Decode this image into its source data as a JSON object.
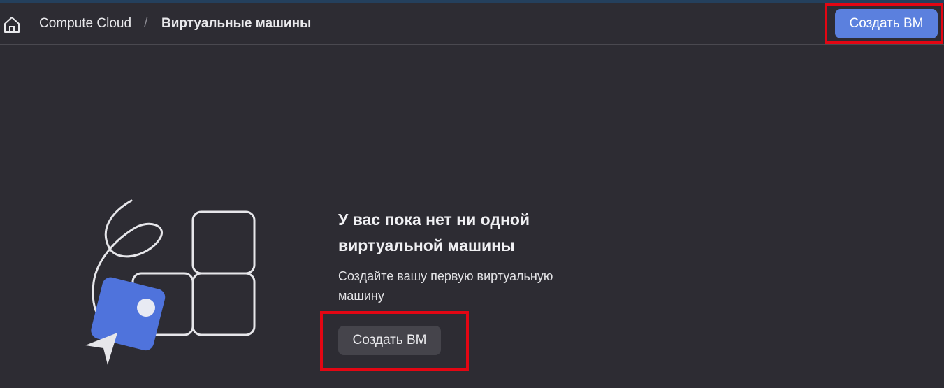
{
  "header": {
    "breadcrumb": {
      "service": "Compute Cloud",
      "separator": "/",
      "current": "Виртуальные машины"
    },
    "create_button_label": "Создать ВМ"
  },
  "empty_state": {
    "title": "У вас пока нет ни одной виртуальной машины",
    "description": "Создайте вашу первую виртуальную машину",
    "create_button_label": "Создать ВМ",
    "illustration_icon": "empty-vm-illustration"
  },
  "colors": {
    "background": "#2d2c33",
    "primary_button": "#5b80de",
    "secondary_button": "#45444b",
    "highlight_border": "#e30613",
    "accent_card": "#4f73dc"
  }
}
